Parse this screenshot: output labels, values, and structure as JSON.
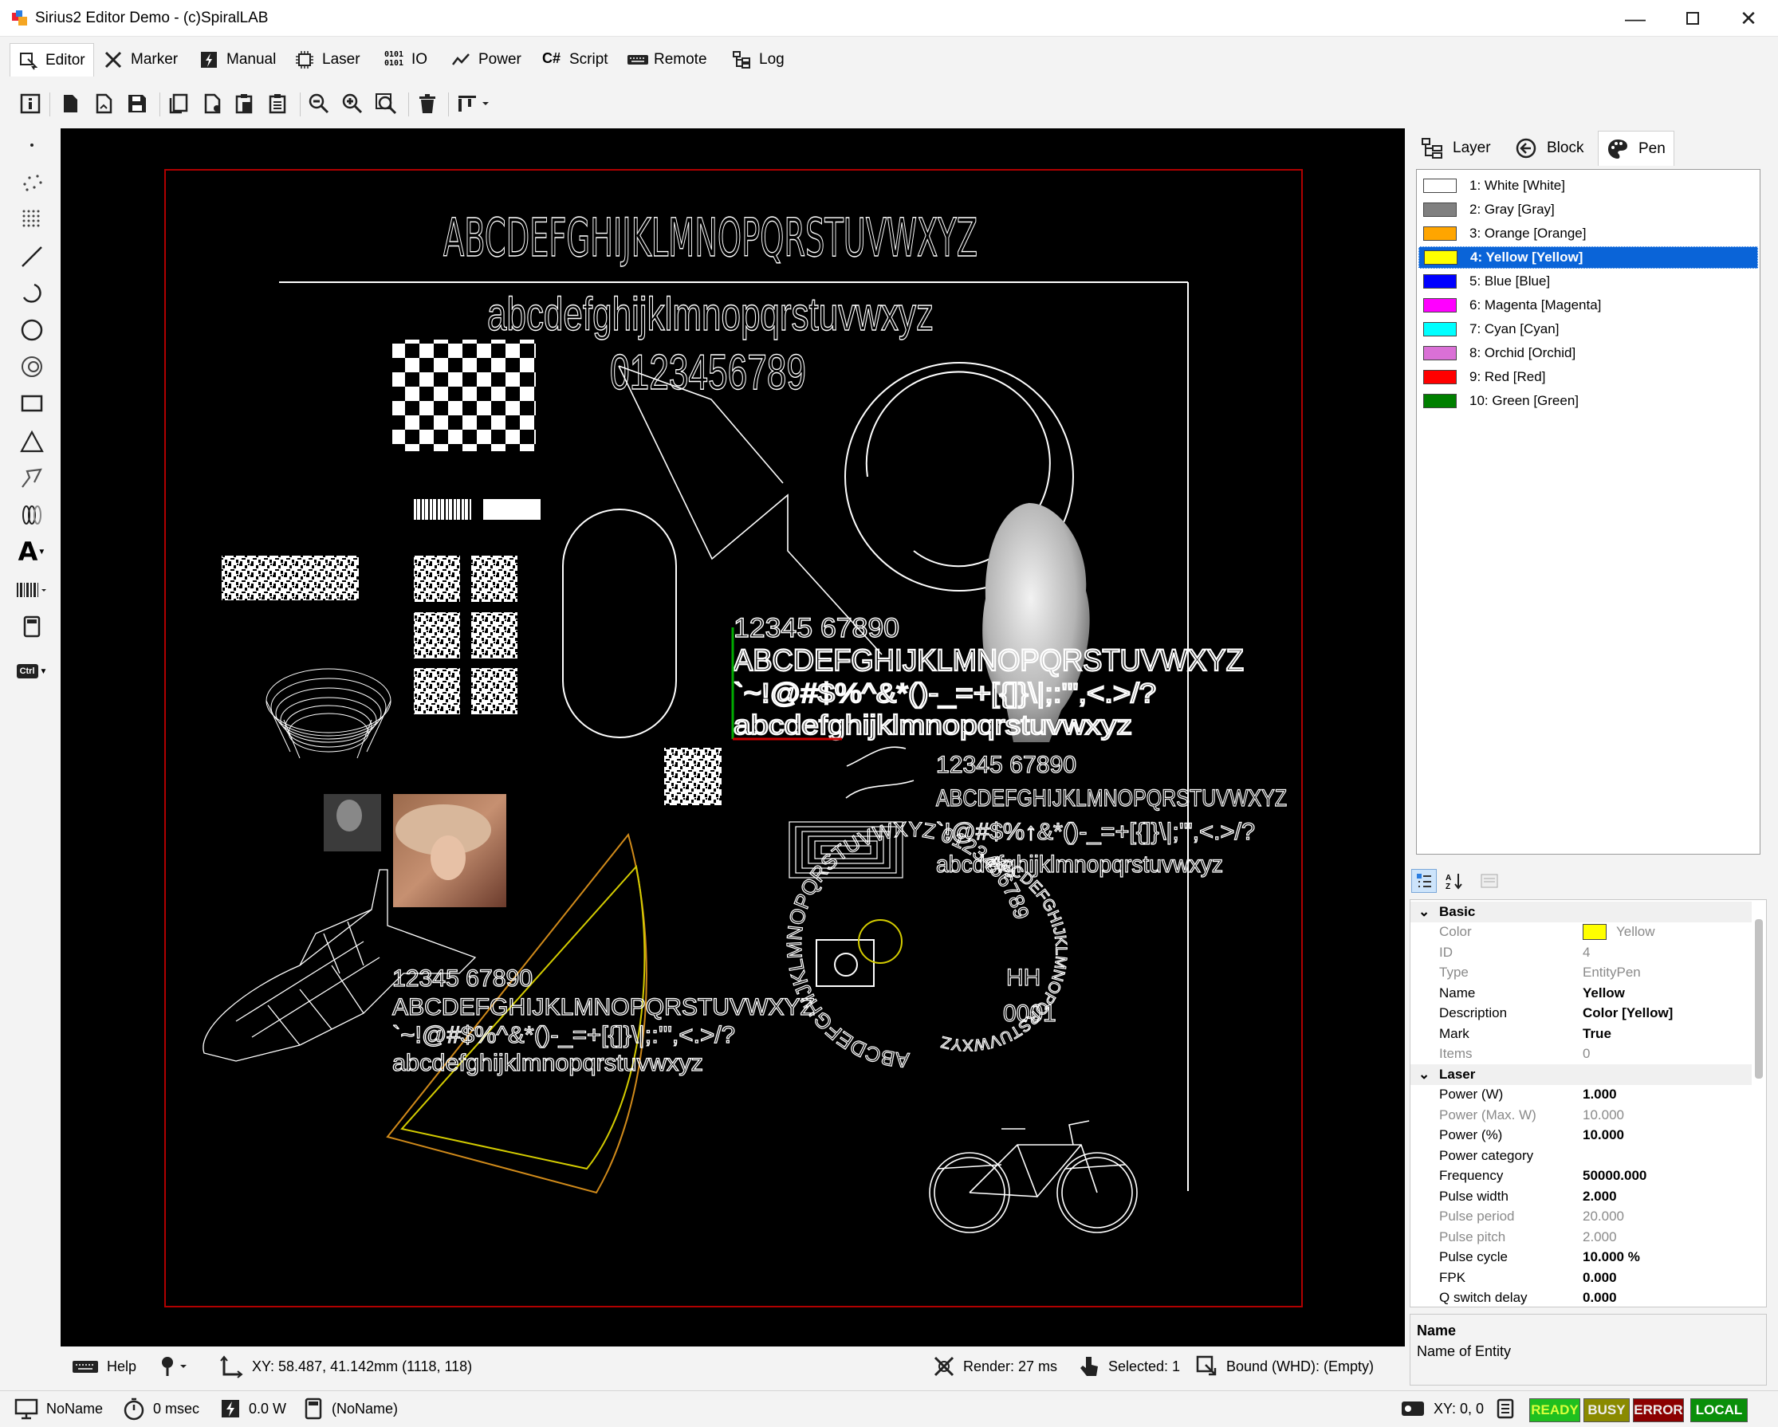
{
  "window": {
    "title": "Sirius2 Editor Demo - (c)SpiralLAB"
  },
  "tabs": [
    {
      "label": "Editor"
    },
    {
      "label": "Marker"
    },
    {
      "label": "Manual"
    },
    {
      "label": "Laser"
    },
    {
      "label": "IO"
    },
    {
      "label": "Power"
    },
    {
      "label": "Script"
    },
    {
      "label": "Remote"
    },
    {
      "label": "Log"
    }
  ],
  "right_tabs": [
    {
      "label": "Layer"
    },
    {
      "label": "Block"
    },
    {
      "label": "Pen"
    }
  ],
  "pens": [
    {
      "label": "1: White [White]",
      "color": "#ffffff"
    },
    {
      "label": "2: Gray [Gray]",
      "color": "#808080"
    },
    {
      "label": "3: Orange [Orange]",
      "color": "#ffa500"
    },
    {
      "label": "4: Yellow [Yellow]",
      "color": "#ffff00"
    },
    {
      "label": "5: Blue [Blue]",
      "color": "#0000ff"
    },
    {
      "label": "6: Magenta [Magenta]",
      "color": "#ff00ff"
    },
    {
      "label": "7: Cyan [Cyan]",
      "color": "#00ffff"
    },
    {
      "label": "8: Orchid [Orchid]",
      "color": "#da70d6"
    },
    {
      "label": "9: Red [Red]",
      "color": "#ff0000"
    },
    {
      "label": "10: Green [Green]",
      "color": "#008000"
    }
  ],
  "selected_pen_index": 3,
  "properties": {
    "basic": {
      "title": "Basic",
      "rows": [
        {
          "name": "Color",
          "value": "Yellow",
          "swatch": "#ffff00"
        },
        {
          "name": "ID",
          "value": "4"
        },
        {
          "name": "Type",
          "value": "EntityPen"
        },
        {
          "name": "Name",
          "value": "Yellow"
        },
        {
          "name": "Description",
          "value": "Color [Yellow]"
        },
        {
          "name": "Mark",
          "value": "True"
        },
        {
          "name": "Items",
          "value": "0"
        }
      ]
    },
    "laser": {
      "title": "Laser",
      "rows": [
        {
          "name": "Power (W)",
          "value": "1.000"
        },
        {
          "name": "Power (Max. W)",
          "value": "10.000"
        },
        {
          "name": "Power (%)",
          "value": "10.000"
        },
        {
          "name": "Power category",
          "value": ""
        },
        {
          "name": "Frequency",
          "value": "50000.000"
        },
        {
          "name": "Pulse width",
          "value": "2.000"
        },
        {
          "name": "Pulse period",
          "value": "20.000"
        },
        {
          "name": "Pulse pitch",
          "value": "2.000"
        },
        {
          "name": "Pulse cycle",
          "value": "10.000 %"
        },
        {
          "name": "FPK",
          "value": "0.000"
        },
        {
          "name": "Q switch delay",
          "value": "0.000"
        }
      ]
    }
  },
  "description_pane": {
    "title": "Name",
    "text": "Name of Entity"
  },
  "canvas_text": {
    "upper": "ABCDEFGHIJKLMNOPQRSTUVWXYZ",
    "lower": "abcdefghijklmnopqrstuvwxyz",
    "digits": "0123456789",
    "nums": "12345 67890",
    "symbols": "`~!@#$%^&*()-_=+[{]}\\|;:'\",<.>/?",
    "symbols2": "`!@#$%↑&*()-_=+[{]}\\|;'\",<.>/?",
    "hh": "HH",
    "serial": "0001",
    "arc_outer": "ABCDEFGHIJKLMNOPQRSTUVWXYZ 0123456789",
    "arc_inner": "ABCDEFGHIJKLMNOPQRSTUVWXYZ 0123456789"
  },
  "statusbar": {
    "help": "Help",
    "xy": "XY: 58.487, 41.142mm (1118, 118)",
    "render": "Render: 27 ms",
    "selected": "Selected: 1",
    "bound": "Bound (WHD): (Empty)"
  },
  "bottombar": {
    "name": "NoName",
    "time": "0 msec",
    "power": "0.0 W",
    "doc": "(NoName)",
    "xy": "XY: 0, 0",
    "ready": "READY",
    "busy": "BUSY",
    "error": "ERROR",
    "local": "LOCAL"
  },
  "status_colors": {
    "ready": "#1fbf1f",
    "busy": "#8a8a00",
    "error": "#8b0000",
    "local": "#0a8f0a"
  }
}
